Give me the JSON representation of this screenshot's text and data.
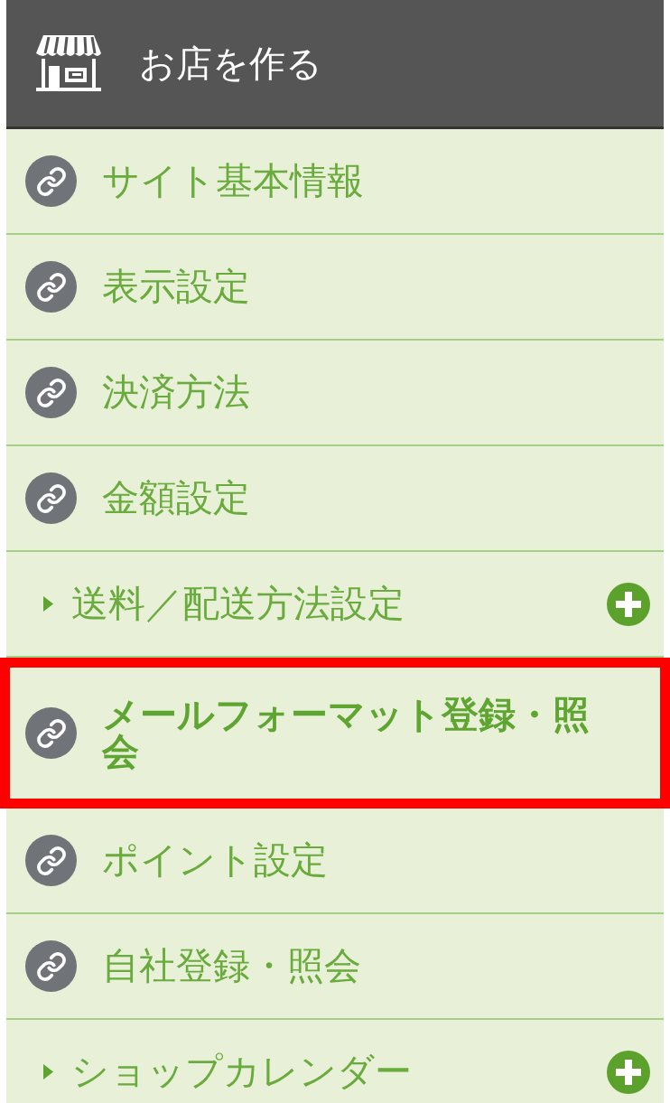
{
  "header": {
    "title": "お店を作る"
  },
  "menu": {
    "items": [
      {
        "kind": "link",
        "label": "サイト基本情報",
        "selected": false
      },
      {
        "kind": "link",
        "label": "表示設定",
        "selected": false
      },
      {
        "kind": "link",
        "label": "決済方法",
        "selected": false
      },
      {
        "kind": "link",
        "label": "金額設定",
        "selected": false
      },
      {
        "kind": "group",
        "label": "送料／配送方法設定",
        "selected": false,
        "expanded": false
      },
      {
        "kind": "link",
        "label": "メールフォーマット登録・照会",
        "selected": true
      },
      {
        "kind": "link",
        "label": "ポイント設定",
        "selected": false
      },
      {
        "kind": "link",
        "label": "自社登録・照会",
        "selected": false
      },
      {
        "kind": "group",
        "label": "ショップカレンダー",
        "selected": false,
        "expanded": false
      }
    ]
  }
}
